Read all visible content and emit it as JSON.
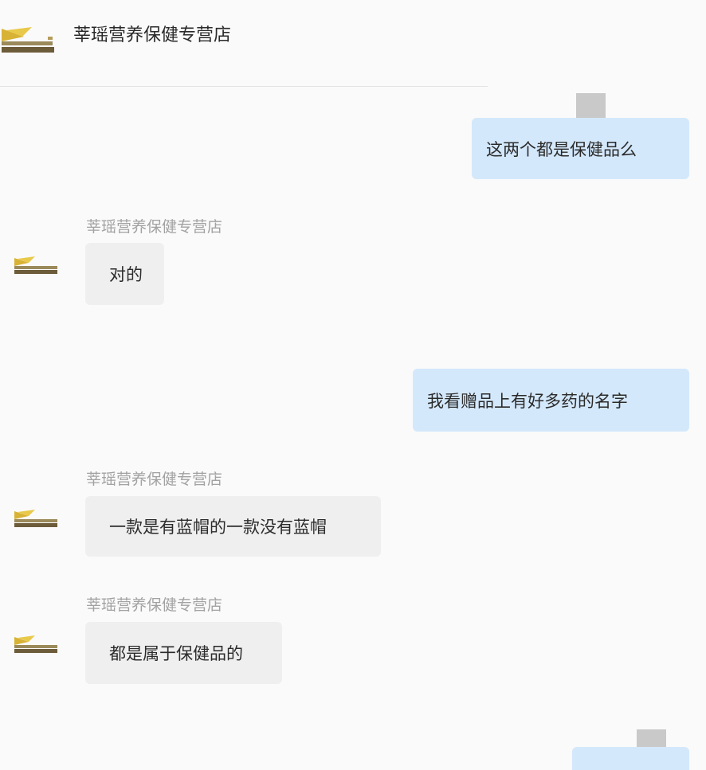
{
  "header": {
    "title": "莘瑶营养保健专营店"
  },
  "messages": [
    {
      "direction": "outgoing",
      "text": "这两个都是保健品么"
    },
    {
      "direction": "incoming",
      "sender": "莘瑶营养保健专营店",
      "text": "对的"
    },
    {
      "direction": "outgoing",
      "text": "我看赠品上有好多药的名字"
    },
    {
      "direction": "incoming",
      "sender": "莘瑶营养保健专营店",
      "text": "一款是有蓝帽的一款没有蓝帽"
    },
    {
      "direction": "incoming",
      "sender": "莘瑶营养保健专营店",
      "text": "都是属于保健品的"
    },
    {
      "direction": "outgoing",
      "text": ""
    }
  ],
  "colors": {
    "background": "#fafafa",
    "outgoing_bubble": "#d4e8fb",
    "incoming_bubble": "#efefef",
    "sender_name": "#a2a2a2",
    "status_marker": "#c9c9c9"
  },
  "icons": {
    "shop_logo": "shop-logo-icon"
  }
}
